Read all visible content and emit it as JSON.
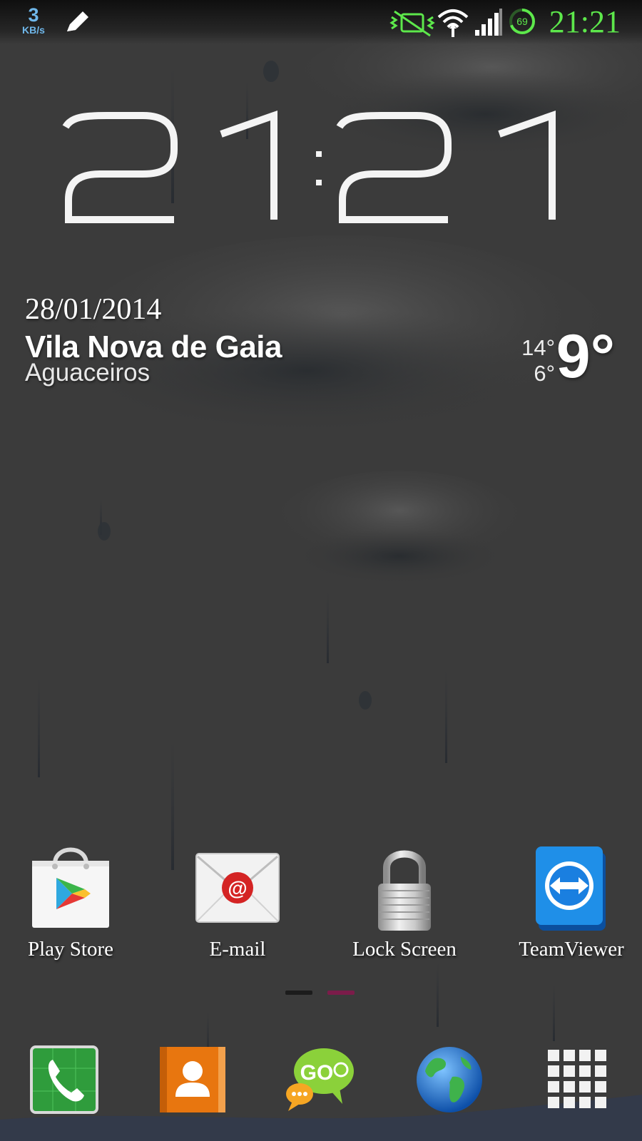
{
  "status_bar": {
    "net_rate_value": "3",
    "net_rate_unit": "KB/s",
    "battery_level": "69",
    "time": "21:21",
    "accent_color": "#5de84b",
    "icons": [
      "edit-icon",
      "vibrate-silent-icon",
      "wifi-icon",
      "signal-icon",
      "battery-icon"
    ]
  },
  "clock": {
    "hours": "21",
    "minutes": "21"
  },
  "weather": {
    "date": "28/01/2014",
    "city": "Vila Nova de Gaia",
    "condition": "Aguaceiros",
    "high": "14°",
    "low": "6°",
    "current": "9°"
  },
  "apps": [
    {
      "label": "Play Store",
      "icon": "play-store-icon"
    },
    {
      "label": "E-mail",
      "icon": "email-icon"
    },
    {
      "label": "Lock Screen",
      "icon": "lock-icon"
    },
    {
      "label": "TeamViewer",
      "icon": "teamviewer-icon"
    }
  ],
  "pager": {
    "pages": 2,
    "active": 2
  },
  "dock": [
    {
      "icon": "phone-icon"
    },
    {
      "icon": "contacts-icon"
    },
    {
      "icon": "go-sms-icon"
    },
    {
      "icon": "browser-globe-icon"
    },
    {
      "icon": "app-drawer-icon"
    }
  ]
}
